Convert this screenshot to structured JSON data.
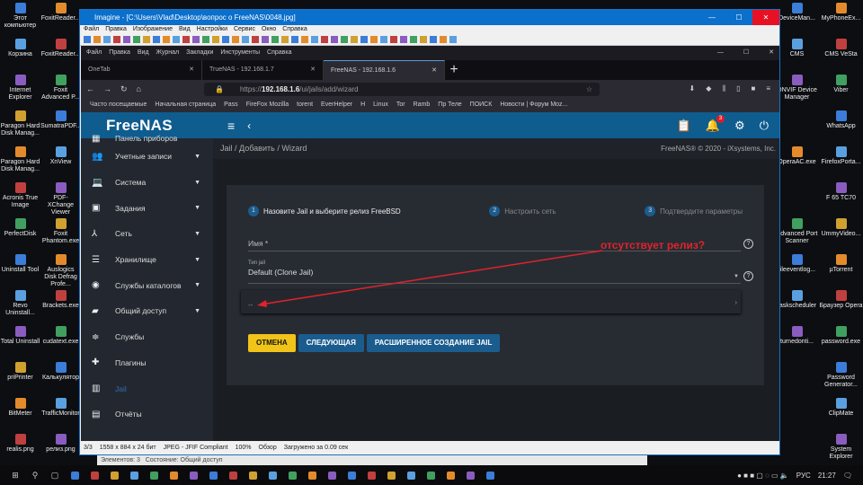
{
  "desktop": {
    "left_icons": [
      "Этот компьютер",
      "FoxitReader...",
      "Корзина",
      "FoxitReader...",
      "Internet Explorer",
      "Foxit Advanced P...",
      "Paragon Hard Disk Manag...",
      "SumatraPDF...",
      "Paragon Hard Disk Manag...",
      "XnView",
      "Acronis True Image",
      "PDF-XChange Viewer",
      "PerfectDisk",
      "Foxit Phantom.exe",
      "Uninstall Tool",
      "Auslogics Disk Defrag Profe...",
      "Revo Uninstall...",
      "Brackets.exe",
      "Total Uninstall",
      "cudatext.exe",
      "priPrinter",
      "Калькулятор",
      "BitMeter",
      "TrafficMonitor",
      "realis.png",
      "релиз.png"
    ],
    "right_icons": [
      "DeviceMan...",
      "MyPhoneEx...",
      "CMS",
      "CMS VeSta",
      "ONVIF Device Manager",
      "Viber",
      "",
      "WhatsApp",
      "OperaAC.exe",
      "FirefoxPorta...",
      "",
      "F 65 TC70",
      "Advanced Port Scanner",
      "UmmyVideo...",
      "fileeventlog...",
      "µTorrent",
      "taskscheduler",
      "Браузер Opera",
      "turnedonti...",
      "password.exe",
      "",
      "Password Generator...",
      "",
      "ClipMate",
      "",
      "System Explorer"
    ]
  },
  "imagine": {
    "title": "Imagine - [C:\\Users\\Vlad\\Desktop\\вопрос о FreeNAS\\0048.jpg]",
    "menu": [
      "Файл",
      "Правка",
      "Изображение",
      "Вид",
      "Настройки",
      "Сервис",
      "Окно",
      "Справка"
    ],
    "status": {
      "index": "3/3",
      "dims": "1558 x 884 x 24 бит",
      "format": "JPEG - JFIF Compliant",
      "zoom": "100%",
      "mode": "Обзор",
      "load": "Загружено за 0.09 сек"
    }
  },
  "firefox": {
    "menu": [
      "Файл",
      "Правка",
      "Вид",
      "Журнал",
      "Закладки",
      "Инструменты",
      "Справка"
    ],
    "tabs": [
      {
        "label": "OneTab"
      },
      {
        "label": "TrueNAS - 192.168.1.7"
      },
      {
        "label": "FreeNAS - 192.168.1.6",
        "active": true
      }
    ],
    "url_prefix": "https://",
    "url_host": "192.168.1.6",
    "url_path": "/ui/jails/add/wizard",
    "bookmarks": [
      "Часто посещаемые",
      "Начальная страница",
      "Pass",
      "FireFox Mozilla",
      "torent",
      "EverHelper",
      "H",
      "Linux",
      "Tor",
      "Ramb",
      "Пр Теле",
      "ПОИСК",
      "Новости | Форум Moz..."
    ]
  },
  "freenas": {
    "logo": "FreeNAS",
    "notifications": "3",
    "breadcrumb": [
      "Jail",
      "Добавить",
      "Wizard"
    ],
    "copyright": "FreeNAS® © 2020 - iXsystems, Inc.",
    "sidebar": [
      {
        "label": "Панель приборов",
        "icon": "dashboard-icon"
      },
      {
        "label": "Учетные записи",
        "icon": "people-icon",
        "arrow": true
      },
      {
        "label": "Система",
        "icon": "laptop-icon",
        "arrow": true
      },
      {
        "label": "Задания",
        "icon": "calendar-icon",
        "arrow": true
      },
      {
        "label": "Сеть",
        "icon": "network-icon",
        "arrow": true
      },
      {
        "label": "Хранилище",
        "icon": "storage-icon",
        "arrow": true
      },
      {
        "label": "Службы каталогов",
        "icon": "directory-icon",
        "arrow": true
      },
      {
        "label": "Общий доступ",
        "icon": "folder-share-icon",
        "arrow": true
      },
      {
        "label": "Службы",
        "icon": "tune-icon"
      },
      {
        "label": "Плагины",
        "icon": "puzzle-icon"
      },
      {
        "label": "Jail",
        "icon": "jail-icon",
        "active": true
      },
      {
        "label": "Отчёты",
        "icon": "chart-icon"
      }
    ],
    "steps": [
      {
        "n": "1",
        "label": "Назовите Jail и выберите релиз FreeBSD"
      },
      {
        "n": "2",
        "label": "Настроить сеть"
      },
      {
        "n": "3",
        "label": "Подтвердите параметры"
      }
    ],
    "name_label": "Имя *",
    "type_label": "Тип jail",
    "type_value": "Default (Clone Jail)",
    "release_value": "--",
    "buttons": {
      "cancel": "ОТМЕНА",
      "next": "СЛЕДУЮЩАЯ",
      "advanced": "РАСШИРЕННОЕ СОЗДАНИЕ JAIL"
    },
    "annotation": "отсутствует релиз?",
    "annotation_color": "#e2222c",
    "accent": "#0f5c8f"
  },
  "explorer_behind": "Элементов: 3   Состояние: Общий доступ",
  "taskbar": {
    "lang": "РУС",
    "time": "21:27"
  }
}
